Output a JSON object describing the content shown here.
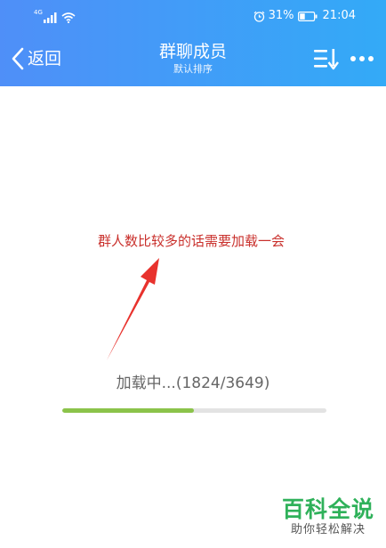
{
  "theme": {
    "nav_gradient_start": "#4f8ff8",
    "nav_gradient_end": "#33aaf7",
    "annotation_color": "#c9302c",
    "progress_color": "#8bc34a"
  },
  "status_bar": {
    "network": "4G",
    "battery_percent": "31%",
    "time": "21:04",
    "icons": [
      "signal-icon",
      "wifi-icon",
      "alarm-icon",
      "battery-icon"
    ]
  },
  "nav": {
    "back_label": "返回",
    "title": "群聊成员",
    "subtitle": "默认排序",
    "icons": [
      "chevron-left-icon",
      "sort-icon",
      "more-icon"
    ]
  },
  "annotation": {
    "text": "群人数比较多的话需要加载一会"
  },
  "loading": {
    "text": "加载中...(1824/3649)",
    "loaded": 1824,
    "total": 3649,
    "progress_fraction": 0.4999
  },
  "watermark": {
    "main": "百科全说",
    "sub": "助你轻松解决"
  }
}
